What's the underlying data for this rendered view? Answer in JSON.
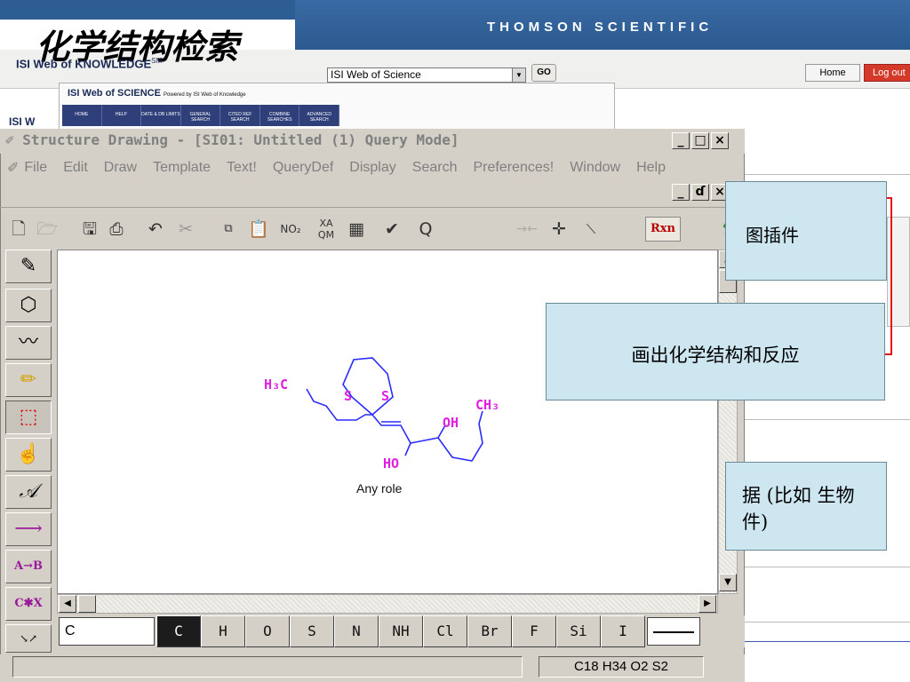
{
  "slide": {
    "title": "化学结构检索",
    "brand": "THOMSON SCIENTIFIC"
  },
  "wok": {
    "logo": "ISI Web of KNOWLEDGE",
    "logo_sup": "SM",
    "db_select": "ISI Web of Science",
    "go": "GO",
    "home": "Home",
    "logout": "Log out",
    "inner_title_prefix": "ISI Web of ",
    "inner_title_bold": "SCIENCE",
    "inner_powered": "Powered by ISI Web of Knowledge",
    "toolbar": [
      "HOME",
      "HELP",
      "DATE & DB LIMITS",
      "GENERAL SEARCH",
      "CITED REF SEARCH",
      "COMBINE SEARCHES",
      "ADVANCED SEARCH"
    ],
    "bg_text": "ISI W"
  },
  "window": {
    "title": "Structure Drawing - [SI01:  Untitled (1)  Query Mode]",
    "min": "_",
    "max": "□",
    "close": "×",
    "restore": "ɗ",
    "menu": [
      "File",
      "Edit",
      "Draw",
      "Template",
      "Text!",
      "QueryDef",
      "Display",
      "Search",
      "Preferences!",
      "Window",
      "Help"
    ],
    "rxn": "Rxn",
    "no2": "NO₂",
    "q": "Q"
  },
  "canvas": {
    "role_label": "Any role",
    "labels": {
      "h3c": "H₃C",
      "s1": "S",
      "s2": "S",
      "oh1": "OH",
      "ch3": "CH₃",
      "ho": "HO"
    },
    "atom_color": "#e020e0"
  },
  "palette": [
    "pencil",
    "ring",
    "chain",
    "eraser",
    "select",
    "lasso",
    "text",
    "arrow",
    "A→B",
    "C*X",
    "map"
  ],
  "palette_labels": {
    "ab": "A→B",
    "cx": "C✱X",
    "text": "𝒜"
  },
  "elements": {
    "input_value": "C",
    "items": [
      "C",
      "H",
      "O",
      "S",
      "N",
      "NH",
      "Cl",
      "Br",
      "F",
      "Si",
      "I"
    ]
  },
  "status": {
    "formula": "C18 H34 O2 S2"
  },
  "callouts": {
    "c1": "图插件",
    "c2": "画出化学结构和反应",
    "c3_line1": "据 (比如 生物",
    "c3_line2": "件)"
  }
}
